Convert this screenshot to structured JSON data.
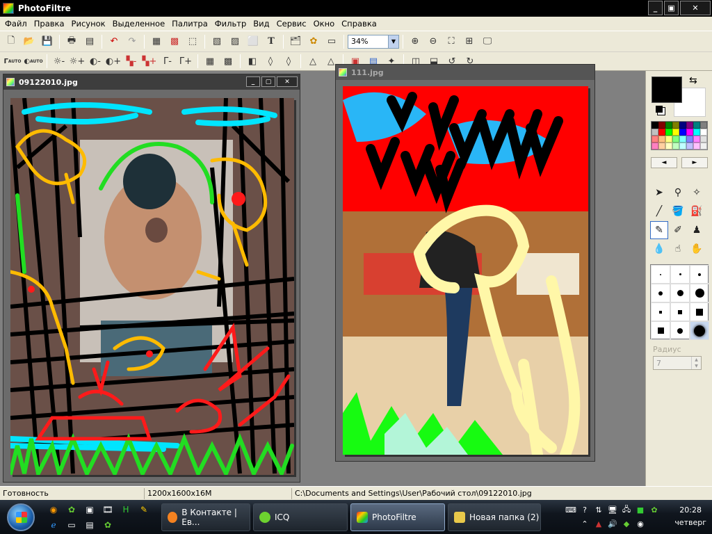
{
  "app": {
    "title": "PhotoFiltre"
  },
  "menu": [
    "Файл",
    "Правка",
    "Рисунок",
    "Выделенное",
    "Палитра",
    "Фильтр",
    "Вид",
    "Сервис",
    "Окно",
    "Справка"
  ],
  "toolbar": {
    "zoom_value": "34%",
    "auto_label_1": "AUTO",
    "auto_label_2": "AUTO"
  },
  "documents": [
    {
      "title": "09122010.jpg"
    },
    {
      "title": "111.jpg"
    }
  ],
  "panel": {
    "radius_label": "Радиус",
    "radius_value": "7",
    "foreground_color": "#000000",
    "background_color": "#ffffff",
    "palette": [
      "#000000",
      "#800000",
      "#008000",
      "#808000",
      "#000080",
      "#800080",
      "#008080",
      "#808080",
      "#c0c0c0",
      "#ff0000",
      "#00ff00",
      "#ffff00",
      "#0000ff",
      "#ff00ff",
      "#00ffff",
      "#ffffff",
      "#ff8080",
      "#ffc080",
      "#ffff80",
      "#80ff80",
      "#80ffff",
      "#8080ff",
      "#ff80ff",
      "#e0e0e0",
      "#ff80c0",
      "#ffd0a0",
      "#ffffc0",
      "#c0ffc0",
      "#c0ffff",
      "#c0c0ff",
      "#ffc0ff",
      "#f0f0f0"
    ]
  },
  "status": {
    "state": "Готовность",
    "size": "1200x1600x16M",
    "path": "C:\\Documents and Settings\\User\\Рабочий стол\\09122010.jpg"
  },
  "taskbar": {
    "tasks": [
      {
        "label": "В Контакте | Ев...",
        "color": "#f58220"
      },
      {
        "label": "ICQ",
        "color": "#6dd12f"
      },
      {
        "label": "PhotoFiltre",
        "color": "#c0c0c0"
      },
      {
        "label": "Новая папка (2)",
        "color": "#e8c84a"
      }
    ],
    "clock_time": "20:28",
    "clock_day": "четверг"
  }
}
